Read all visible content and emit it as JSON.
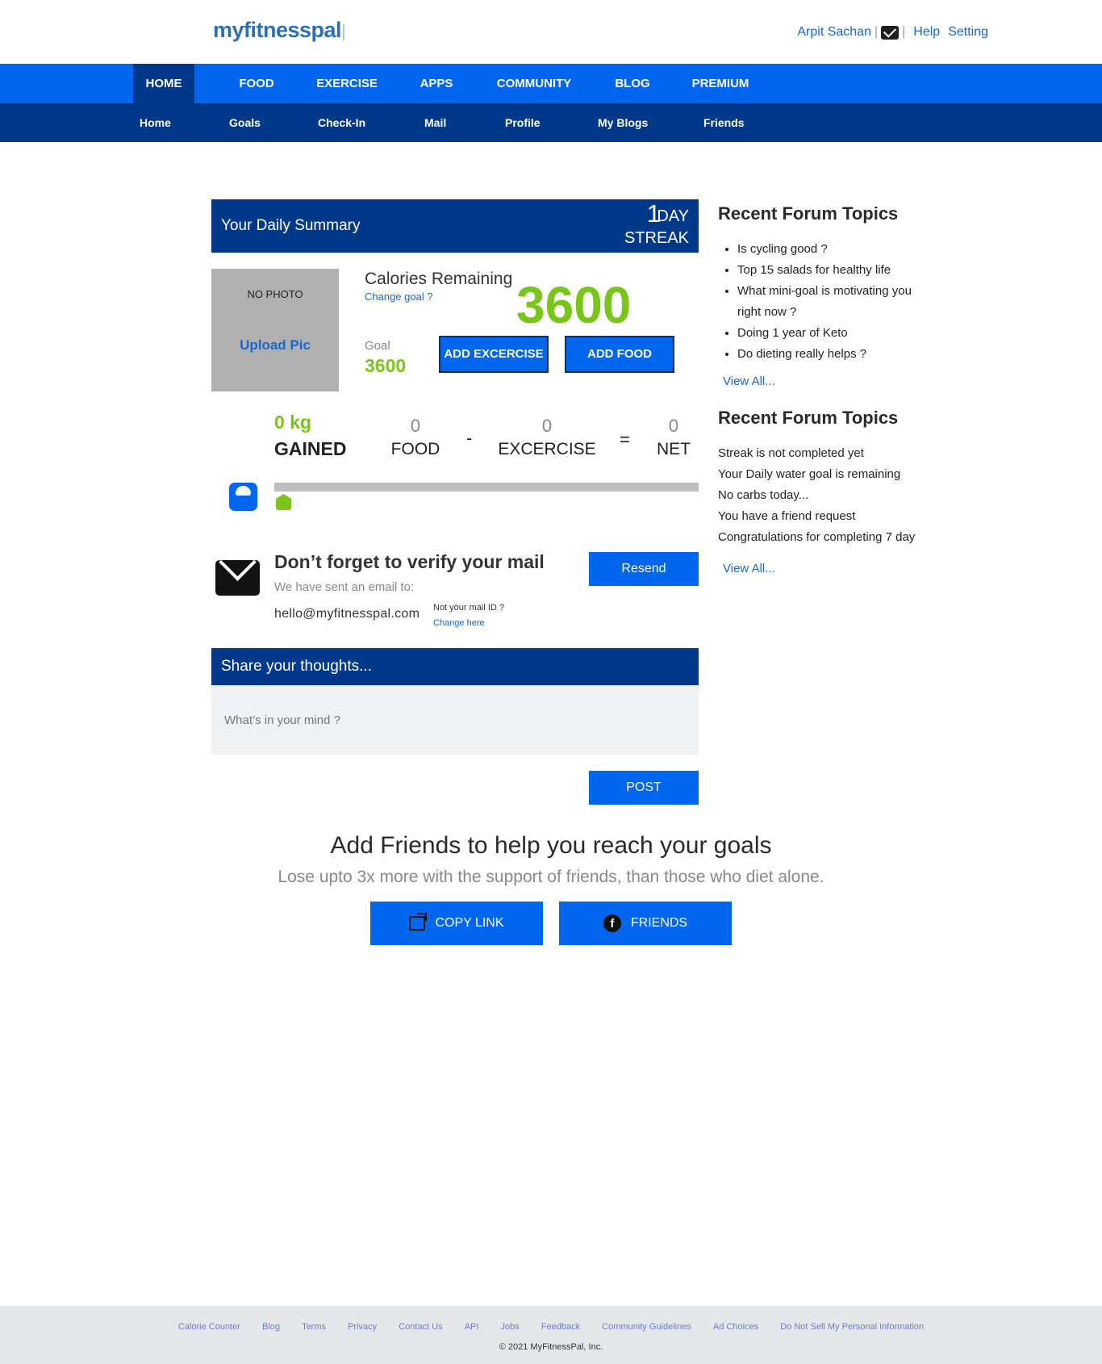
{
  "header": {
    "logo": "myfitnesspal",
    "user_name": "Arpit Sachan",
    "help": "Help",
    "setting": "Setting"
  },
  "main_nav": [
    "HOME",
    "FOOD",
    "EXERCISE",
    "APPS",
    "COMMUNITY",
    "BLOG",
    "PREMIUM"
  ],
  "sub_nav": [
    "Home",
    "Goals",
    "Check-In",
    "Mail",
    "Profile",
    "My Blogs",
    "Friends"
  ],
  "summary": {
    "title": "Your Daily Summary",
    "streak_count": "1",
    "streak_day": "DAY",
    "streak_label": "STREAK",
    "no_photo": "NO PHOTO",
    "upload_pic": "Upload Pic",
    "calories_remaining_label": "Calories Remaining",
    "change_goal": "Change goal ?",
    "calories_remaining": "3600",
    "goal_label": "Goal",
    "goal_value": "3600",
    "add_exercise": "ADD EXCERCISE",
    "add_food": "ADD FOOD"
  },
  "stats": {
    "gained_value": "0 kg",
    "gained_label": "GAINED",
    "food_value": "0",
    "food_label": "FOOD",
    "minus": "-",
    "exercise_value": "0",
    "exercise_label": "EXCERCISE",
    "equals": "=",
    "net_value": "0",
    "net_label": "NET",
    "progress": 0
  },
  "verify": {
    "title": "Don’t forget to verify your mail",
    "subtitle": "We have sent an email to:",
    "email": "hello@myfitnesspal.com",
    "not_your_mail": "Not your mail ID ?",
    "change_here": "Change here",
    "resend": "Resend"
  },
  "share": {
    "title": "Share your thoughts...",
    "placeholder": "What’s in your mind ?",
    "post": "POST"
  },
  "friends": {
    "title": "Add Friends to help you reach your goals",
    "subtitle": "Lose upto 3x more with the support of friends, than those who diet alone.",
    "copy_link": "COPY LINK",
    "friends_button": "FRIENDS"
  },
  "sidebar": {
    "forum_title": "Recent Forum Topics",
    "forum_topics": [
      "Is cycling good ?",
      "Top 15 salads for healthy life",
      "What mini-goal is motivating you right now ?",
      "Doing 1 year of Keto",
      "Do dieting really helps ?"
    ],
    "forum_view_all": "View All...",
    "notifications_title": "Recent Forum Topics",
    "notifications": [
      "Streak is not completed yet",
      "Your Daily water goal is remaining",
      "No carbs today...",
      "You have a friend request",
      "Congratulations for completing 7 day"
    ],
    "notifications_view_all": "View All..."
  },
  "footer": {
    "links": [
      "Calorie Counter",
      "Blog",
      "Terms",
      "Privacy",
      "Contact Us",
      "API",
      "Jobs",
      "Feedback",
      "Community Guidelines",
      "Ad Choices",
      "Do Not Sell My Personal Information"
    ],
    "copyright": "© 2021 MyFitnessPal, Inc."
  },
  "colors": {
    "primary_blue": "#0066ee",
    "dark_blue": "#00388a",
    "green": "#7ac51a"
  }
}
